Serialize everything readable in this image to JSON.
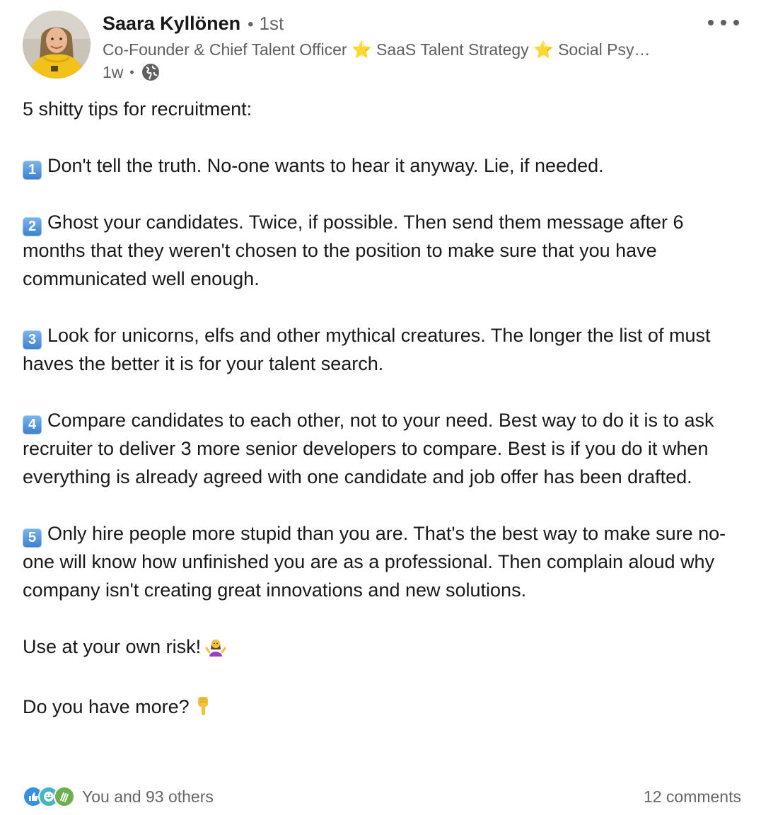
{
  "author": {
    "name": "Saara Kyllönen",
    "degree_separator": "•",
    "connection_degree": "1st",
    "headline": "Co-Founder & Chief Talent Officer ⭐ SaaS Talent Strategy ⭐ Social Psy…",
    "time_ago": "1w",
    "meta_separator": "•",
    "visibility_icon": "globe-icon"
  },
  "post": {
    "intro": "5 shitty tips for recruitment:",
    "tips": [
      {
        "number": "1",
        "text": "Don't tell the truth. No-one wants to hear it anyway. Lie, if needed."
      },
      {
        "number": "2",
        "text": "Ghost your candidates. Twice, if possible. Then send them message after 6 months that they weren't chosen to the position to make sure that you have communicated well enough."
      },
      {
        "number": "3",
        "text": "Look for unicorns, elfs and other mythical creatures. The longer the list of must haves the better it is for your talent search."
      },
      {
        "number": "4",
        "text": "Compare candidates to each other, not to your need. Best way to do it is to ask recruiter to deliver 3 more senior developers to compare. Best is if you do it when everything is already agreed with one candidate and job offer has been drafted."
      },
      {
        "number": "5",
        "text": "Only hire people more stupid than you are. That's the best way to make sure no-one will know how unfinished you are as a professional. Then complain aloud why company isn't creating great innovations and new solutions."
      }
    ],
    "closing": "Use at your own risk!",
    "closing_icon": "shrugging-woman-icon",
    "question": "Do you have more?",
    "question_icon": "pointing-down-icon"
  },
  "social": {
    "reaction_icons": [
      "like-icon",
      "funny-icon",
      "celebrate-icon"
    ],
    "reactions_text": "You and 93 others",
    "comments_text": "12 comments"
  },
  "colors": {
    "name": "#191919",
    "secondary_text": "#5f5f5f",
    "badge_blue": "#3a7fcf",
    "like_blue": "#378fe9",
    "funny_teal": "#44b6c3",
    "celebrate_green": "#6dae4f"
  }
}
